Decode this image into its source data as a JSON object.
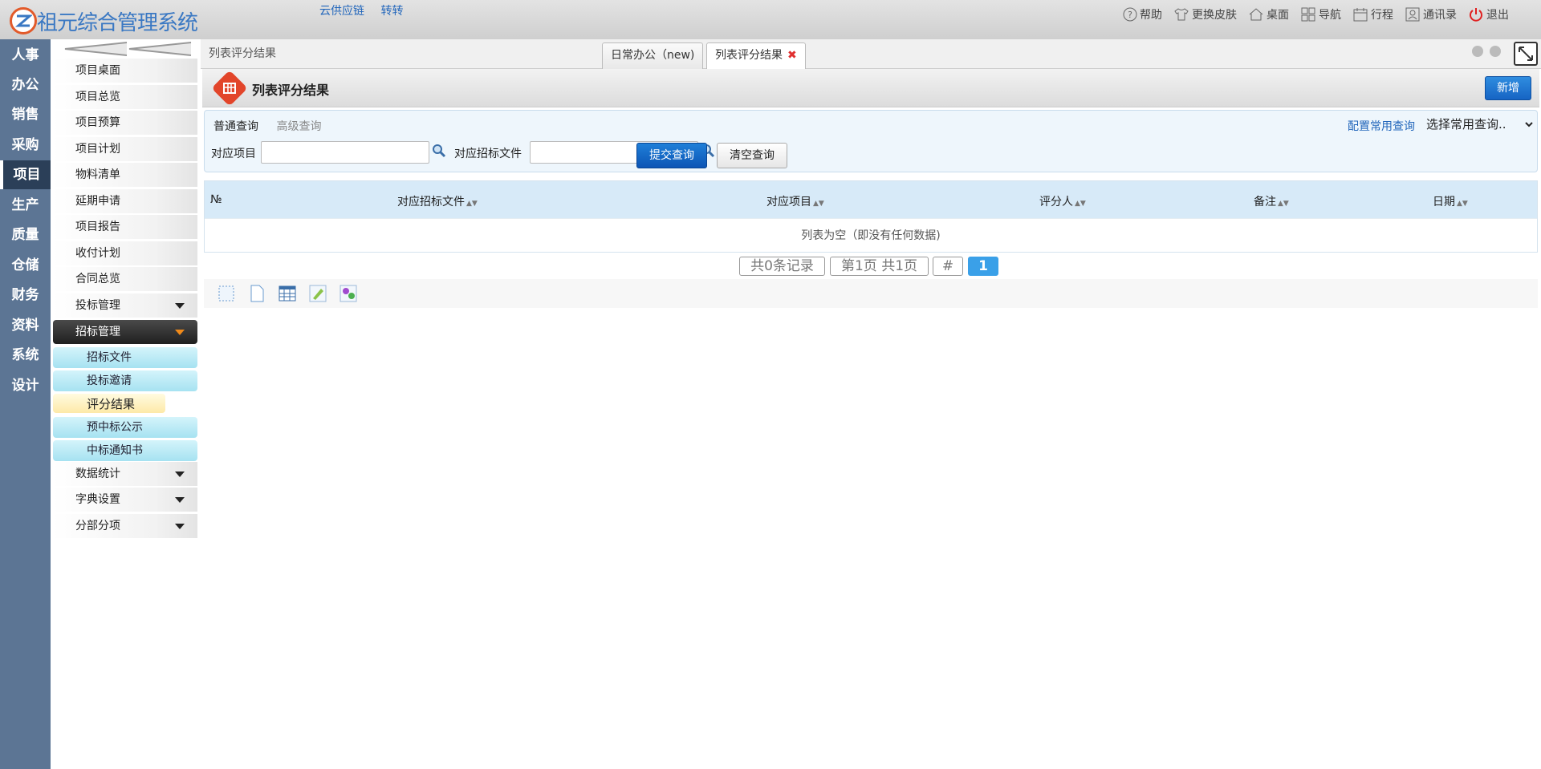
{
  "app": {
    "name": "祖元综合管理系统",
    "top_links": [
      "云供应链",
      "转转"
    ],
    "top_menu": [
      {
        "label": "帮助",
        "icon": "help-icon"
      },
      {
        "label": "更换皮肤",
        "icon": "shirt-icon"
      },
      {
        "label": "桌面",
        "icon": "home-icon"
      },
      {
        "label": "导航",
        "icon": "grid-icon"
      },
      {
        "label": "行程",
        "icon": "calendar-icon"
      },
      {
        "label": "通讯录",
        "icon": "contact-icon"
      },
      {
        "label": "退出",
        "icon": "power-icon"
      }
    ]
  },
  "nav": [
    "人事",
    "办公",
    "销售",
    "采购",
    "项目",
    "生产",
    "质量",
    "仓储",
    "财务",
    "资料",
    "系统",
    "设计"
  ],
  "nav_active": "项目",
  "sidebar": {
    "items": [
      "项目桌面",
      "项目总览",
      "项目预算",
      "项目计划",
      "物料清单",
      "延期申请",
      "项目报告",
      "收付计划",
      "合同总览"
    ],
    "groups": {
      "bid_manage": "投标管理",
      "tender_manage": "招标管理",
      "stats": "数据统计",
      "dict": "字典设置",
      "parts": "分部分项"
    },
    "sub_items": [
      "招标文件",
      "投标邀请",
      "评分结果",
      "预中标公示",
      "中标通知书"
    ],
    "sub_selected": "评分结果"
  },
  "tabs": {
    "breadcrumb": "列表评分结果",
    "items": [
      {
        "label": "日常办公（new)"
      },
      {
        "label": "列表评分结果",
        "close": "✖"
      }
    ]
  },
  "page": {
    "title": "列表评分结果",
    "add_button": "新增"
  },
  "search": {
    "tab_normal": "普通查询",
    "tab_advanced": "高级查询",
    "config_link": "配置常用查询",
    "preset_select": "选择常用查询..",
    "field1_label": "对应项目",
    "field1_value": "",
    "field2_label": "对应招标文件",
    "field2_value": "",
    "submit": "提交查询",
    "clear": "清空查询"
  },
  "grid": {
    "columns": [
      "№",
      "对应招标文件",
      "对应项目",
      "评分人",
      "备注",
      "日期"
    ],
    "empty_text": "列表为空（即没有任何数据)"
  },
  "pager": {
    "total": "共0条记录",
    "page_info": "第1页 共1页",
    "jump": "#",
    "current": "1"
  },
  "colors": {
    "nav_bg": "#5c7594",
    "accent": "#1664c4",
    "brand": "#3a78c3"
  }
}
